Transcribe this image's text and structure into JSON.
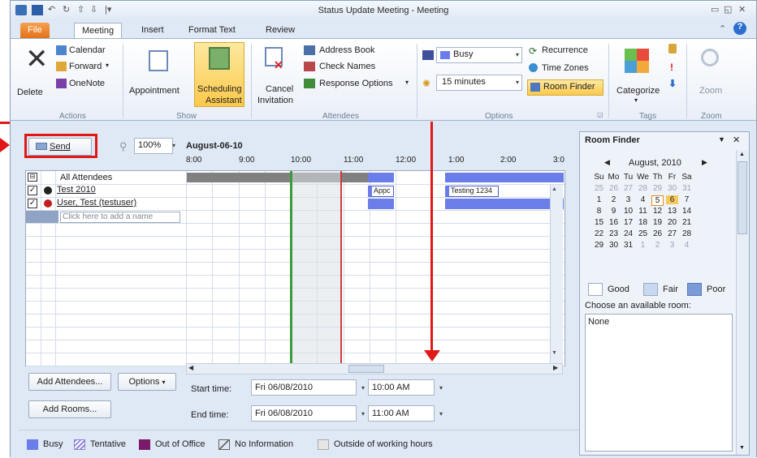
{
  "window": {
    "title": "Status Update Meeting - Meeting"
  },
  "tabs": [
    "File",
    "Meeting",
    "Insert",
    "Format Text",
    "Review"
  ],
  "ribbon": {
    "actions": {
      "delete": "Delete",
      "calendar": "Calendar",
      "forward": "Forward",
      "onenote": "OneNote",
      "group": "Actions"
    },
    "show": {
      "appointment": "Appointment",
      "scheduling_1": "Scheduling",
      "scheduling_2": "Assistant",
      "group": "Show"
    },
    "attendees": {
      "cancel_1": "Cancel",
      "cancel_2": "Invitation",
      "address_book": "Address Book",
      "check_names": "Check Names",
      "response_options": "Response Options",
      "group": "Attendees"
    },
    "options": {
      "show_as": "Busy",
      "reminder": "15 minutes",
      "recurrence": "Recurrence",
      "time_zones": "Time Zones",
      "room_finder": "Room Finder",
      "group": "Options"
    },
    "tags": {
      "categorize": "Categorize",
      "group": "Tags"
    },
    "zoom": {
      "zoom": "Zoom",
      "group": "Zoom"
    }
  },
  "scheduling": {
    "send": "Send",
    "zoom_value": "100%",
    "date": "August-06-10",
    "times": [
      "8:00",
      "9:00",
      "10:00",
      "11:00",
      "12:00",
      "1:00",
      "2:00",
      "3:0"
    ],
    "all_attendees": "All Attendees",
    "attendees": [
      {
        "name": "Test 2010"
      },
      {
        "name": "User, Test (testuser)"
      }
    ],
    "add_name_placeholder": "Click here to add a name",
    "events": {
      "appt": "Appc",
      "testing": "Testing 1234"
    },
    "add_attendees": "Add Attendees...",
    "options_btn": "Options",
    "add_rooms": "Add Rooms...",
    "start_label": "Start time:",
    "end_label": "End time:",
    "start_date": "Fri 06/08/2010",
    "start_time": "10:00 AM",
    "end_date": "Fri 06/08/2010",
    "end_time": "11:00 AM"
  },
  "legend": [
    "Busy",
    "Tentative",
    "Out of Office",
    "No Information",
    "Outside of working hours"
  ],
  "room_finder": {
    "title": "Room Finder",
    "month": "August, 2010",
    "weekdays": [
      "Su",
      "Mo",
      "Tu",
      "We",
      "Th",
      "Fr",
      "Sa"
    ],
    "weeks": [
      [
        "25",
        "26",
        "27",
        "28",
        "29",
        "30",
        "31"
      ],
      [
        "1",
        "2",
        "3",
        "4",
        "5",
        "6",
        "7"
      ],
      [
        "8",
        "9",
        "10",
        "11",
        "12",
        "13",
        "14"
      ],
      [
        "15",
        "16",
        "17",
        "18",
        "19",
        "20",
        "21"
      ],
      [
        "22",
        "23",
        "24",
        "25",
        "26",
        "27",
        "28"
      ],
      [
        "29",
        "30",
        "31",
        "1",
        "2",
        "3",
        "4"
      ]
    ],
    "quality": [
      "Good",
      "Fair",
      "Poor"
    ],
    "choose_label": "Choose an available room:",
    "rooms": [
      "None"
    ]
  },
  "colors": {
    "busy": "#6b7de8",
    "tentative": "#8f86d8",
    "oof": "#7a1a6a",
    "annotation": "#e01818"
  }
}
